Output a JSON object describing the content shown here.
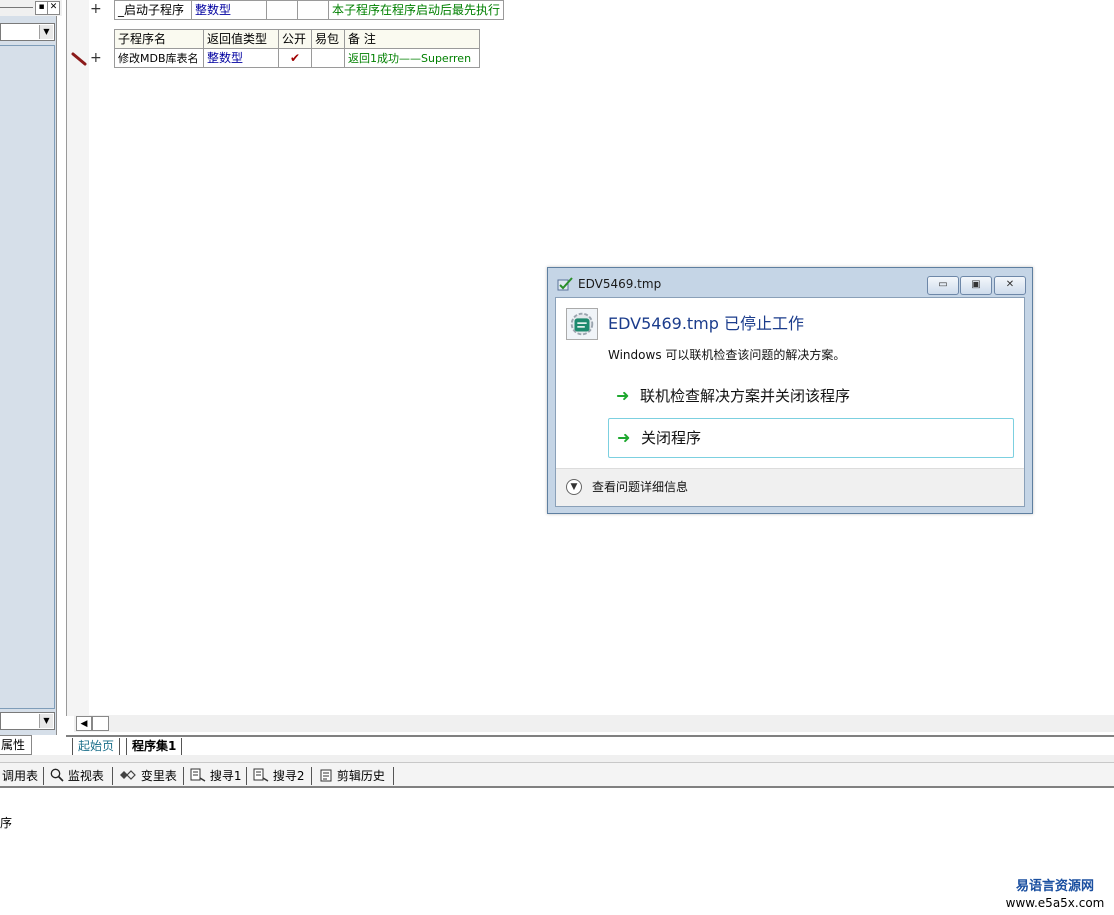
{
  "left_panel": {
    "tab_label": "属性"
  },
  "editor": {
    "row1": {
      "name": "_启动子程序",
      "type": "整数型",
      "comment": "本子程序在程序启动后最先执行"
    },
    "headers": [
      "子程序名",
      "返回值类型",
      "公开",
      "易包",
      "备 注"
    ],
    "row2": {
      "name": "修改MDB库表名",
      "type": "整数型",
      "public_mark": "✔",
      "comment": "返回1成功——Superren"
    },
    "plus": "+"
  },
  "tabs": [
    "起始页",
    "程序集1"
  ],
  "bottom_toolbar": {
    "items": [
      {
        "label": "调用表",
        "icon": "call-table-icon"
      },
      {
        "label": "监视表",
        "icon": "magnifier-icon"
      },
      {
        "label": "变里表",
        "icon": "variable-icon"
      },
      {
        "label": "搜寻1",
        "icon": "search-list-icon"
      },
      {
        "label": "搜寻2",
        "icon": "search-list-icon"
      },
      {
        "label": "剪辑历史",
        "icon": "clipboard-icon"
      }
    ]
  },
  "output": {
    "text": "序"
  },
  "watermark": {
    "name": "易语言资源网",
    "url": "www.e5a5x.com"
  },
  "dialog": {
    "title": "EDV5469.tmp",
    "heading": "EDV5469.tmp 已停止工作",
    "subtext": "Windows 可以联机检查该问题的解决方案。",
    "option_online": "联机检查解决方案并关闭该程序",
    "option_close": "关闭程序",
    "details": "查看问题详细信息",
    "minimize_glyph": "▭",
    "maximize_glyph": "▣",
    "close_glyph": "✕",
    "arrow_glyph": "➜"
  }
}
